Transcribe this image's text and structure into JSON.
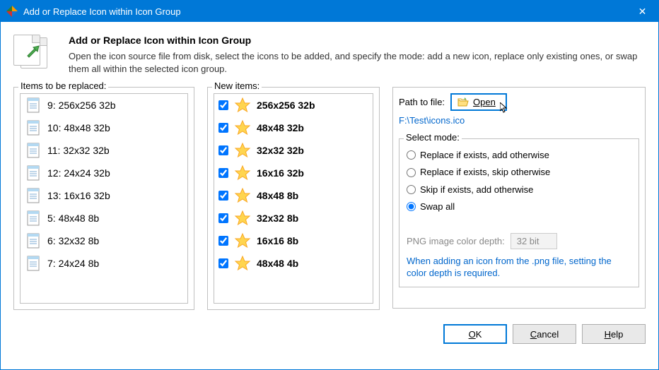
{
  "window": {
    "title": "Add or Replace Icon within Icon Group"
  },
  "header": {
    "title": "Add or Replace Icon within Icon Group",
    "description": "Open the icon source file from disk, select the icons to be added, and specify the mode: add a new icon, replace only existing ones, or swap them all within the selected icon group."
  },
  "labels": {
    "items_replaced": "Items to be replaced:",
    "new_items": "New items:",
    "path_to_file": "Path to file:",
    "open": "Open",
    "select_mode": "Select mode:",
    "png_depth": "PNG image color depth:",
    "png_value": "32 bit",
    "note": "When adding an icon from the .png file, setting the color depth is required."
  },
  "path_value": "F:\\Test\\icons.ico",
  "items_replaced": [
    {
      "label": "9: 256x256 32b"
    },
    {
      "label": "10: 48x48 32b"
    },
    {
      "label": "11: 32x32 32b"
    },
    {
      "label": "12: 24x24 32b"
    },
    {
      "label": "13: 16x16 32b"
    },
    {
      "label": "5: 48x48 8b"
    },
    {
      "label": "6: 32x32 8b"
    },
    {
      "label": "7: 24x24 8b"
    }
  ],
  "new_items": [
    {
      "label": "256x256 32b"
    },
    {
      "label": "48x48 32b"
    },
    {
      "label": "32x32 32b"
    },
    {
      "label": "16x16 32b"
    },
    {
      "label": "48x48 8b"
    },
    {
      "label": "32x32 8b"
    },
    {
      "label": "16x16 8b"
    },
    {
      "label": "48x48 4b"
    }
  ],
  "modes": [
    {
      "label": "Replace if exists, add otherwise",
      "checked": false
    },
    {
      "label": "Replace if exists, skip otherwise",
      "checked": false
    },
    {
      "label": "Skip if exists, add otherwise",
      "checked": false
    },
    {
      "label": "Swap all",
      "checked": true
    }
  ],
  "buttons": {
    "ok": "OK",
    "cancel": "Cancel",
    "help": "Help"
  }
}
